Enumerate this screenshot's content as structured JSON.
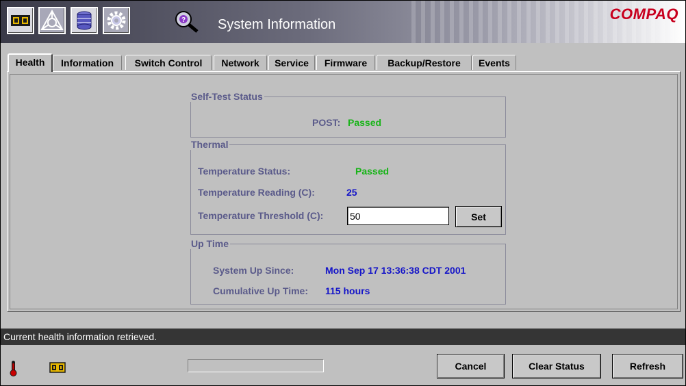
{
  "header": {
    "title": "System Information",
    "logo": "COMPAQ",
    "toolbar_icons": [
      "switch-icon",
      "fabric-icon",
      "storage-icon",
      "settings-icon",
      "info-icon"
    ]
  },
  "tabs": [
    {
      "label": "Health",
      "active": true
    },
    {
      "label": "Information",
      "active": false
    },
    {
      "label": "Switch Control",
      "active": false
    },
    {
      "label": "Network",
      "active": false
    },
    {
      "label": "Service",
      "active": false
    },
    {
      "label": "Firmware",
      "active": false
    },
    {
      "label": "Backup/Restore",
      "active": false
    },
    {
      "label": "Events",
      "active": false
    }
  ],
  "self_test": {
    "title": "Self-Test Status",
    "post_label": "POST:",
    "post_value": "Passed"
  },
  "thermal": {
    "title": "Thermal",
    "status_label": "Temperature Status:",
    "status_value": "Passed",
    "reading_label": "Temperature Reading (C):",
    "reading_value": "25",
    "threshold_label": "Temperature Threshold (C):",
    "threshold_value": "50",
    "set_label": "Set"
  },
  "uptime": {
    "title": "Up Time",
    "since_label": "System Up Since:",
    "since_value": "Mon Sep 17 13:36:38 CDT 2001",
    "cumulative_label": "Cumulative Up Time:",
    "cumulative_value": "115 hours"
  },
  "status": {
    "message": "Current health information retrieved.",
    "progress": 0
  },
  "buttons": {
    "cancel": "Cancel",
    "clear_status": "Clear Status",
    "refresh": "Refresh"
  },
  "colors": {
    "pass": "#18b418",
    "value": "#1414c8",
    "label": "#5a5a8a",
    "logo": "#c8001e"
  }
}
